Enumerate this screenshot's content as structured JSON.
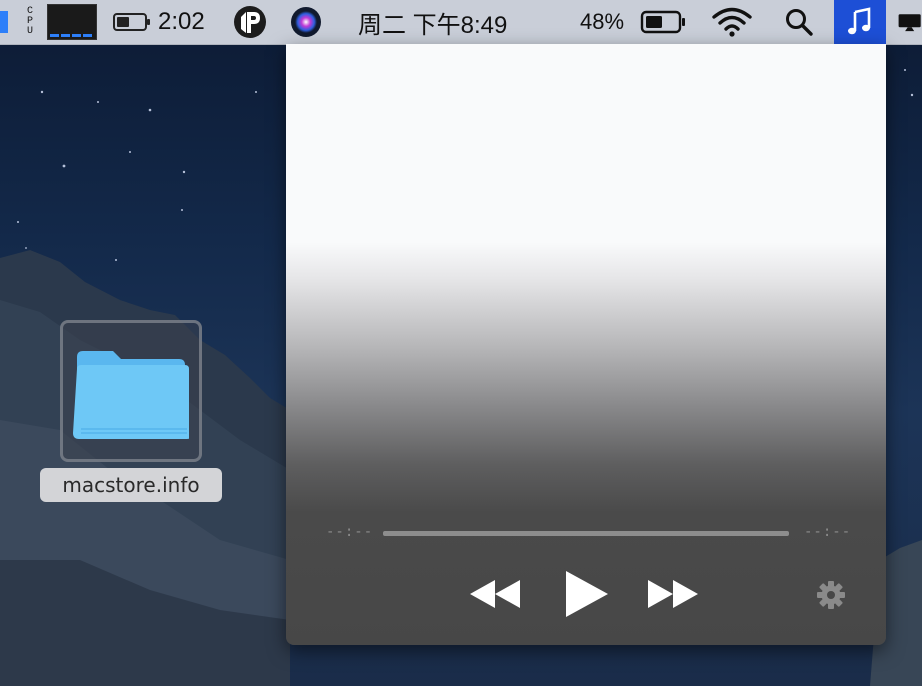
{
  "menubar": {
    "cpu_label": "C\nP\nU",
    "time_left": "2:02",
    "clock": "周二 下午8:49",
    "battery_percent": "48%",
    "icons": [
      "cpu-meter-icon",
      "battery-icon",
      "p-app-icon",
      "siri-icon",
      "battery-icon",
      "wifi-icon",
      "search-icon",
      "music-icon",
      "display-icon"
    ],
    "accent": "#1d4fd6"
  },
  "desktop": {
    "folder_label": "macstore.info",
    "folder_color": "#6ec8f6"
  },
  "player": {
    "elapsed": "--:--",
    "remaining": "--:--",
    "progress": 0,
    "controls": [
      "rewind-icon",
      "play-icon",
      "fast-forward-icon",
      "gear-icon"
    ]
  }
}
